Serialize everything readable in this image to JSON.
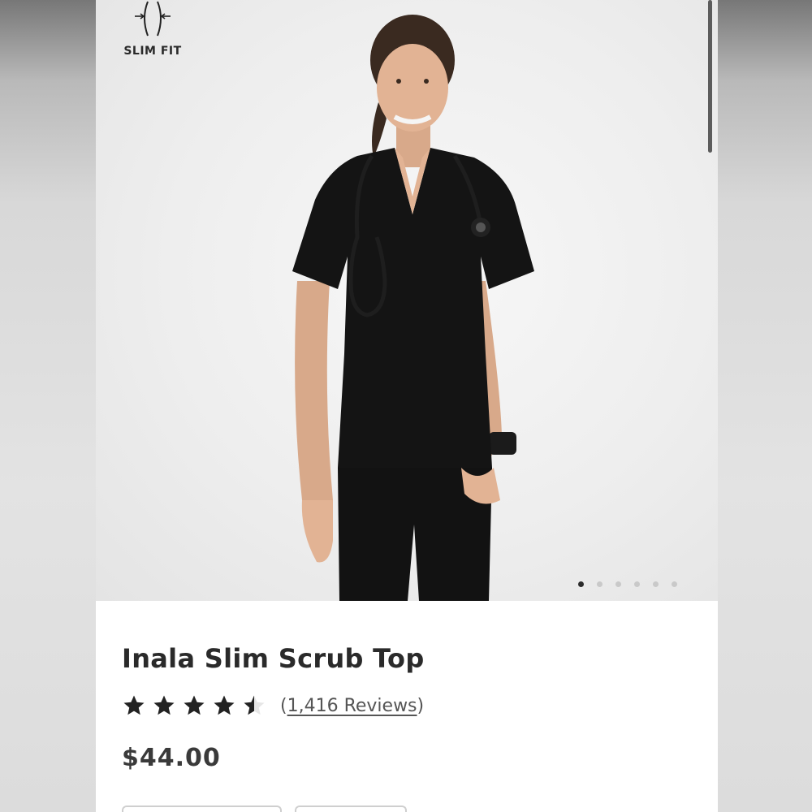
{
  "hero": {
    "fit_badge": {
      "label": "SLIM FIT",
      "icon": "slim-fit-icon"
    },
    "carousel": {
      "total": 6,
      "active_index": 0
    }
  },
  "product": {
    "title": "Inala Slim Scrub Top",
    "rating": {
      "value": 4.5,
      "max": 5
    },
    "reviews_open": "(",
    "reviews_link": "1,416 Reviews",
    "reviews_close": ")",
    "price": "$44.00"
  },
  "colors": {
    "scrub": "#141414",
    "text": "#2a2a2a",
    "muted": "#555555",
    "dot_active": "#2b2b2b",
    "dot_inactive": "#c9c9c9"
  }
}
